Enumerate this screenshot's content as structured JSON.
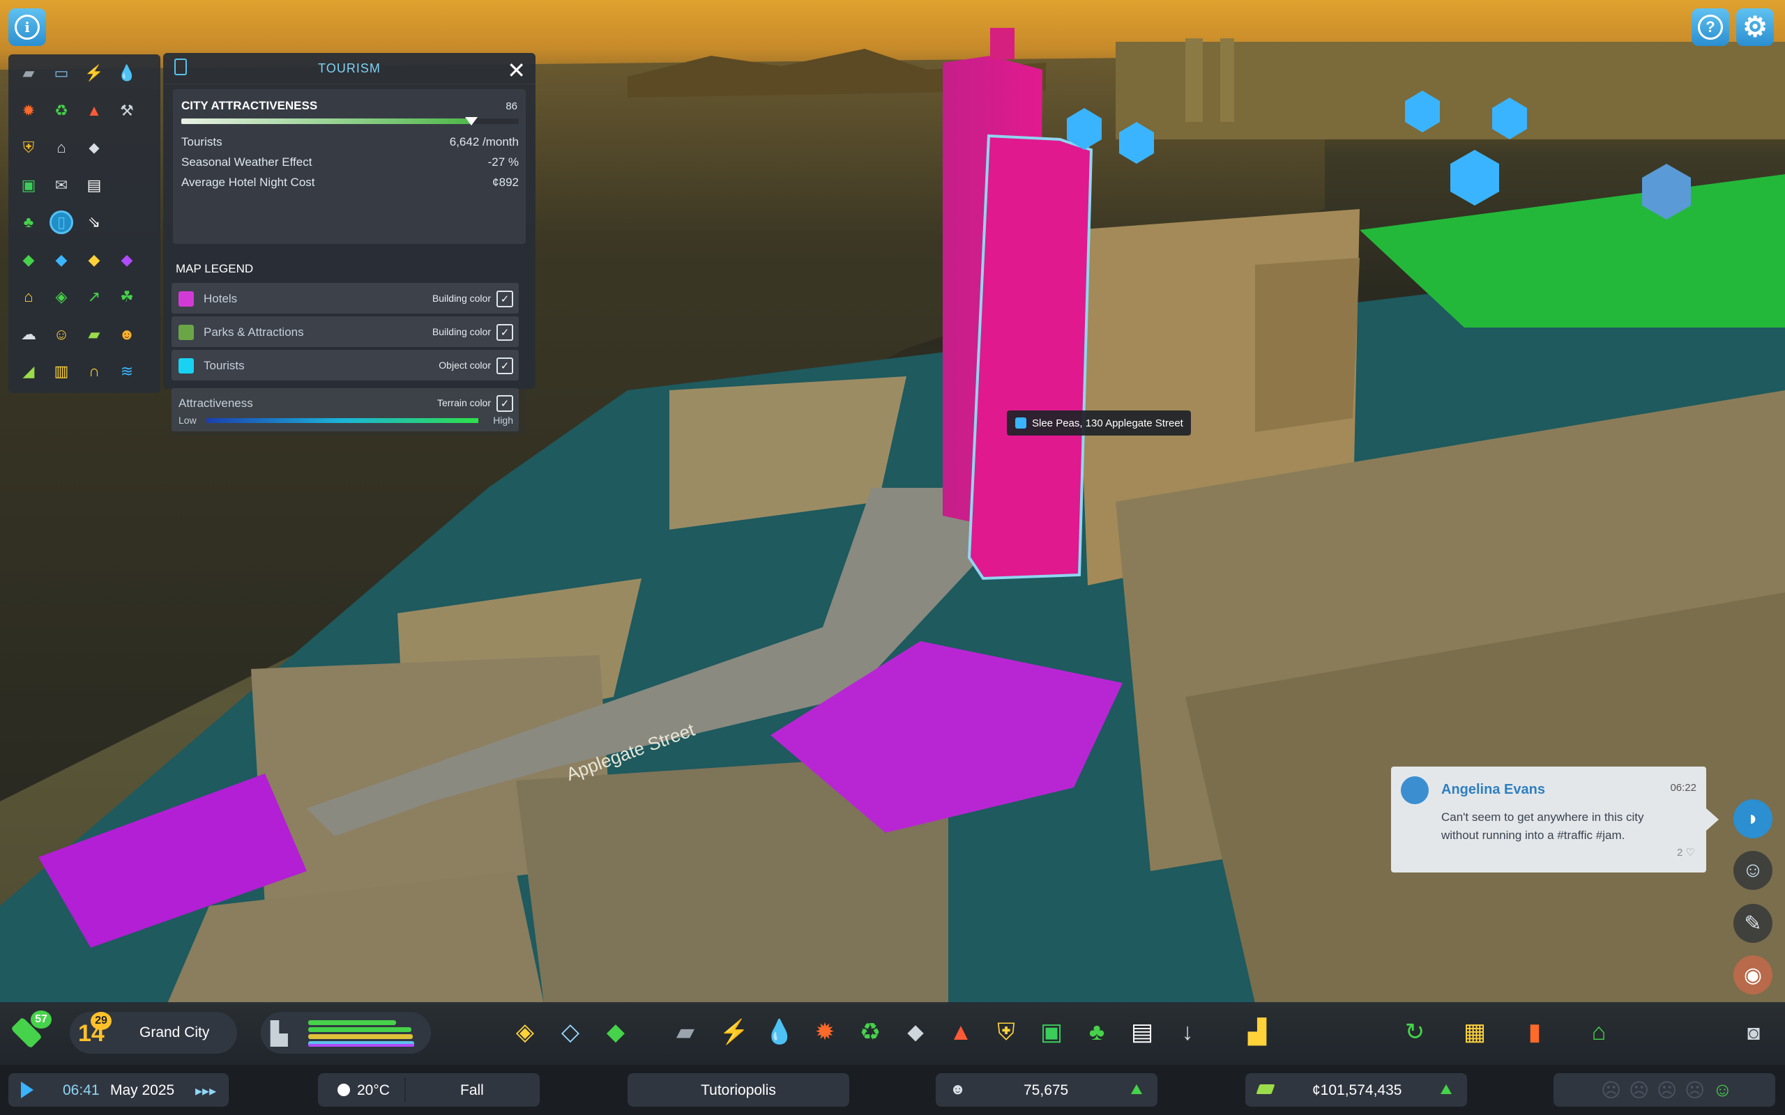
{
  "top": {
    "info_icon": "info-icon",
    "help_icon": "question-icon",
    "settings_icon": "gear-icon"
  },
  "infoview_toolbar": {
    "icons": [
      {
        "name": "road-icon",
        "glyph": "▰",
        "color": "#9aa4ad"
      },
      {
        "name": "bus-icon",
        "glyph": "▭",
        "color": "#7fb8e6"
      },
      {
        "name": "electricity-icon",
        "glyph": "⚡",
        "color": "#ffd23a"
      },
      {
        "name": "water-icon",
        "glyph": "💧",
        "color": "#3aa0ff"
      },
      {
        "name": "health-icon",
        "glyph": "✹",
        "color": "#ff6a2a"
      },
      {
        "name": "recycling-icon",
        "glyph": "♻",
        "color": "#46d24a"
      },
      {
        "name": "fire-icon",
        "glyph": "▲",
        "color": "#ff5a38"
      },
      {
        "name": "services-icon",
        "glyph": "⚒",
        "color": "#cfd6dc"
      },
      {
        "name": "police-icon",
        "glyph": "⛨",
        "color": "#f3b92a"
      },
      {
        "name": "government-icon",
        "glyph": "⌂",
        "color": "#d8dee4"
      },
      {
        "name": "education-icon",
        "glyph": "⬥",
        "color": "#d8dee4"
      },
      {
        "name": "blank-icon",
        "glyph": "",
        "color": "#000000"
      },
      {
        "name": "transport-icon",
        "glyph": "▣",
        "color": "#3acd5a"
      },
      {
        "name": "postal-icon",
        "glyph": "✉",
        "color": "#cfd6dc"
      },
      {
        "name": "communication-icon",
        "glyph": "▤",
        "color": "#ffffff"
      },
      {
        "name": "blank-icon",
        "glyph": "",
        "color": "#000000"
      },
      {
        "name": "parks-icon",
        "glyph": "♣",
        "color": "#46d24a"
      },
      {
        "name": "tourism-icon",
        "glyph": "▯",
        "color": "#5cc1ec"
      },
      {
        "name": "outside-connections-icon",
        "glyph": "⇘",
        "color": "#ffffff"
      },
      {
        "name": "blank-icon",
        "glyph": "",
        "color": "#000000"
      },
      {
        "name": "residential-zone-icon",
        "glyph": "◆",
        "color": "#46d24a"
      },
      {
        "name": "commercial-zone-icon",
        "glyph": "◆",
        "color": "#3ab7ff"
      },
      {
        "name": "industrial-zone-icon",
        "glyph": "◆",
        "color": "#ffd23a"
      },
      {
        "name": "office-zone-icon",
        "glyph": "◆",
        "color": "#b04cff"
      },
      {
        "name": "land-value-icon",
        "glyph": "⌂",
        "color": "#ffd23a"
      },
      {
        "name": "resources-icon",
        "glyph": "◈",
        "color": "#46d24a"
      },
      {
        "name": "economy-icon",
        "glyph": "↗",
        "color": "#46d24a"
      },
      {
        "name": "agriculture-icon",
        "glyph": "☘",
        "color": "#46d24a"
      },
      {
        "name": "population-icon",
        "glyph": "☁",
        "color": "#d8dee4"
      },
      {
        "name": "happiness-icon",
        "glyph": "☺",
        "color": "#ffd23a"
      },
      {
        "name": "money-icon",
        "glyph": "▰",
        "color": "#9bdc4a"
      },
      {
        "name": "workplaces-icon",
        "glyph": "☻",
        "color": "#ffb02a"
      },
      {
        "name": "noise-icon",
        "glyph": "◢",
        "color": "#9bdc4a"
      },
      {
        "name": "garbage-icon",
        "glyph": "▥",
        "color": "#ffd23a"
      },
      {
        "name": "audio-icon",
        "glyph": "∩",
        "color": "#ffd23a"
      },
      {
        "name": "water-pollution-icon",
        "glyph": "≋",
        "color": "#3ab7ff"
      }
    ]
  },
  "tourism": {
    "title": "TOURISM",
    "close_glyph": "✕",
    "attractiveness_label": "CITY ATTRACTIVENESS",
    "attractiveness_value": "86",
    "attractiveness_fraction": 0.86,
    "stats": [
      {
        "label": "Tourists",
        "value": "6,642 /month"
      },
      {
        "label": "Seasonal Weather Effect",
        "value": "-27 %"
      },
      {
        "label": "Average Hotel Night Cost",
        "value": "¢892"
      }
    ],
    "legend_title": "MAP LEGEND",
    "legend": [
      {
        "label": "Hotels",
        "kind": "Building color",
        "color": "#d23ad6"
      },
      {
        "label": "Parks & Attractions",
        "kind": "Building color",
        "color": "#6aa646"
      },
      {
        "label": "Tourists",
        "kind": "Object color",
        "color": "#18d2f2"
      }
    ],
    "gradient": {
      "label": "Attractiveness",
      "kind": "Terrain color",
      "low": "Low",
      "high": "High"
    },
    "check_glyph": "✓"
  },
  "tooltip": {
    "text": "Slee Peas, 130 Applegate Street"
  },
  "map_labels": {
    "street": "Applegate Street"
  },
  "chirp": {
    "name": "Angelina Evans",
    "time": "06:22",
    "message": "Can't seem to get anywhere in this city without running into a #traffic #jam.",
    "likes": "2 ♡"
  },
  "side_buttons": [
    "chirper-icon",
    "citizen-icon",
    "journal-icon",
    "photo-icon"
  ],
  "toolbar": {
    "xp_level": "57",
    "milestone_number": "14",
    "milestone_badge": "29",
    "milestone_name": "Grand City",
    "tools": [
      {
        "name": "zoning-icon",
        "glyph": "◈",
        "color": "#ffd23a"
      },
      {
        "name": "area-icon",
        "glyph": "◇",
        "color": "#9ad8ff"
      },
      {
        "name": "landscaping-icon",
        "glyph": "◆",
        "color": "#46d24a"
      },
      {
        "name": "roads-icon",
        "glyph": "▰",
        "color": "#9aa4ad"
      },
      {
        "name": "electricity-tool-icon",
        "glyph": "⚡",
        "color": "#ffb02a"
      },
      {
        "name": "water-tool-icon",
        "glyph": "💧",
        "color": "#3aa0ff"
      },
      {
        "name": "healthcare-tool-icon",
        "glyph": "✹",
        "color": "#ff6a2a"
      },
      {
        "name": "garbage-tool-icon",
        "glyph": "♻",
        "color": "#46d24a"
      },
      {
        "name": "education-tool-icon",
        "glyph": "⬥",
        "color": "#cfd6dc"
      },
      {
        "name": "fire-tool-icon",
        "glyph": "▲",
        "color": "#ff5a38"
      },
      {
        "name": "police-tool-icon",
        "glyph": "⛨",
        "color": "#ffd23a"
      },
      {
        "name": "transport-tool-icon",
        "glyph": "▣",
        "color": "#3acd5a"
      },
      {
        "name": "parks-tool-icon",
        "glyph": "♣",
        "color": "#46d24a"
      },
      {
        "name": "communication-tool-icon",
        "glyph": "▤",
        "color": "#ffffff"
      },
      {
        "name": "shovel-tool-icon",
        "glyph": "↓",
        "color": "#cfd6dc"
      },
      {
        "name": "bulldozer-icon",
        "glyph": "▟",
        "color": "#ffd23a"
      }
    ],
    "right_tools": [
      {
        "name": "progression-icon",
        "glyph": "↻",
        "color": "#46d24a"
      },
      {
        "name": "map-tiles-icon",
        "glyph": "▦",
        "color": "#ffd23a"
      },
      {
        "name": "statistics-icon",
        "glyph": "▮",
        "color": "#ff6a2a"
      },
      {
        "name": "economy-tool-icon",
        "glyph": "⌂",
        "color": "#46d24a"
      }
    ]
  },
  "status": {
    "time": "06:41",
    "date": "May 2025",
    "speed": "▸▸▸",
    "temperature": "20°C",
    "season": "Fall",
    "city_name": "Tutoriopolis",
    "population": "75,675",
    "money": "¢101,574,435",
    "happiness_faces": [
      "☹",
      "☹",
      "☹",
      "☹",
      "☺"
    ]
  },
  "colors": {
    "accent": "#5cc1ec",
    "hotel": "#d23ad6",
    "park": "#6aa646",
    "tourist": "#18d2f2"
  }
}
